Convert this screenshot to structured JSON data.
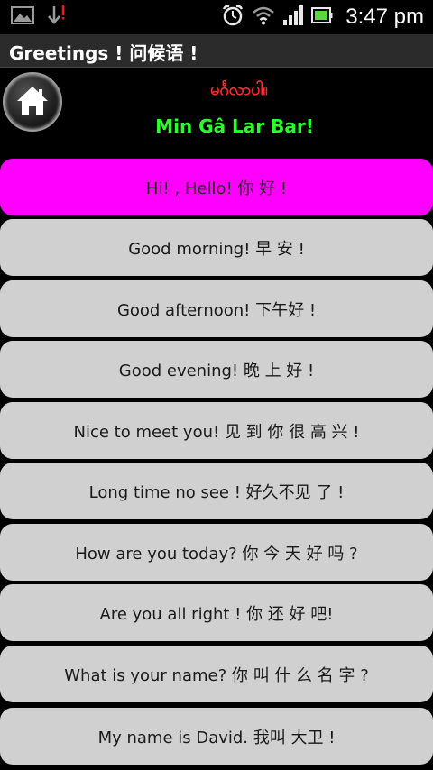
{
  "status_bar": {
    "time": "3:47 pm",
    "icons": [
      "image-notification-icon",
      "download-alert-icon",
      "alarm-clock-icon",
      "wifi-icon",
      "signal-bars-icon",
      "battery-icon"
    ]
  },
  "title_bar": {
    "title": "Greetings ! 问候语 !"
  },
  "header": {
    "home_icon": "home-icon",
    "myanmar_title": "မင်္ဂလာပါ။",
    "subtitle": "Min Gâ Lar Bar!"
  },
  "phrases": [
    {
      "label": "Hi! ,  Hello!   你 好 !",
      "selected": true
    },
    {
      "label": "Good morning!  早 安 !",
      "selected": false
    },
    {
      "label": "Good afternoon! 下午好 !",
      "selected": false
    },
    {
      "label": "Good evening! 晚 上 好 !",
      "selected": false
    },
    {
      "label": "Nice to meet you! 见 到 你 很 高 兴 !",
      "selected": false
    },
    {
      "label": "Long time no see !  好久不见 了 !",
      "selected": false
    },
    {
      "label": "How are you today? 你 今 天 好 吗 ?",
      "selected": false
    },
    {
      "label": "Are you all right ! 你 还 好 吧!",
      "selected": false
    },
    {
      "label": "What is your name? 你 叫 什 么 名 字 ?",
      "selected": false
    },
    {
      "label": "My name is David.  我叫 大卫 !",
      "selected": false
    }
  ],
  "colors": {
    "selected": "#ff00ff",
    "button": "#d0d0d0",
    "myanmar_text": "#ff2a2a",
    "subtitle": "#2bff2b"
  }
}
